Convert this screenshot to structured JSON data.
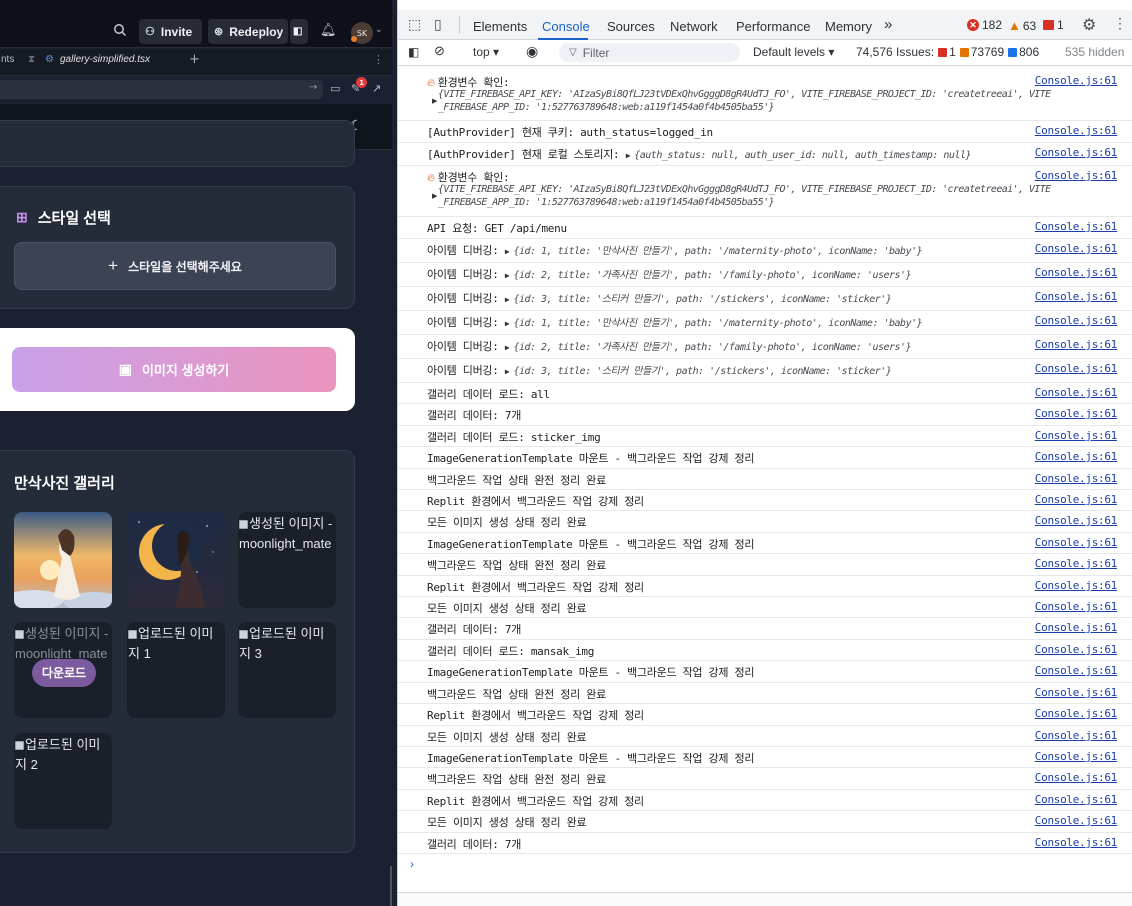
{
  "left": {
    "topbar": {
      "invite_label": "Invite",
      "redeploy_label": "Redeploy",
      "avatar_initials": "SK"
    },
    "tabs": {
      "tab1_label": "nts",
      "tab2_label": "gallery-simplified.tsx"
    },
    "url_badge": "1",
    "style_section": {
      "title": "스타일 선택",
      "button_label": "스타일을 선택해주세요"
    },
    "generate_button_label": "이미지 생성하기",
    "gallery": {
      "title": "만삭사진 갤러리",
      "tiles": [
        {
          "alt": "",
          "kind": "image-maternity-sunset"
        },
        {
          "alt": "",
          "kind": "image-moon-woman"
        },
        {
          "alt": "생성된 이미지 - moonlight_mate"
        },
        {
          "alt": "생성된 이미지 - moonlight_mate",
          "download_label": "다운로드"
        },
        {
          "alt": "업로드된 이미지 1"
        },
        {
          "alt": "업로드된 이미지 3"
        },
        {
          "alt": "업로드된 이미지 2"
        }
      ]
    }
  },
  "devtools": {
    "tabs": [
      "Elements",
      "Console",
      "Sources",
      "Network",
      "Performance",
      "Memory"
    ],
    "more_tabs": "»",
    "errors": "182",
    "warnings": "63",
    "issues_flag": "1",
    "toolbar": {
      "context": "top ▾",
      "filter_placeholder": "Filter",
      "levels": "Default levels ▾",
      "issues_label": "74,576 Issues:",
      "issues_red": "1",
      "issues_orange": "73769",
      "issues_blue": "806",
      "hidden": "535 hidden"
    },
    "source": "Console.js:61",
    "log": {
      "env_check": "환경변수 확인:",
      "env_line1": "{VITE_FIREBASE_API_KEY: 'AIzaSyBi8QfLJ23tVDExQhvGgggD8gR4UdTJ_FO', VITE_FIREBASE_PROJECT_ID: 'createtreeai', VITE",
      "env_line2": "_FIREBASE_APP_ID: '1:527763789648:web:a119f1454a0f4b4505ba55'}",
      "auth_cookie": "[AuthProvider] 현재 쿠키: auth_status=logged_in",
      "auth_local": "[AuthProvider] 현재 로컬 스토리지:",
      "auth_local_obj": "{auth_status: null, auth_user_id: null, auth_timestamp: null}",
      "api_req": "API 요청: GET /api/menu",
      "item_label": "아이템 디버깅:",
      "item1": "{id: 1, title: '만삭사진 만들기', path: '/maternity-photo', iconName: 'baby'}",
      "item2": "{id: 2, title: '가족사진 만들기', path: '/family-photo', iconName: 'users'}",
      "item3": "{id: 3, title: '스티커 만들기', path: '/stickers', iconName: 'sticker'}",
      "gallery_load_all": "갤러리 데이터 로드: all",
      "gallery_data_7": "갤러리 데이터: 7개",
      "gallery_load_sticker": "갤러리 데이터 로드: sticker_img",
      "mount": "ImageGenerationTemplate 마운트 - 백그라운드 작업 강제 정리",
      "bg_cleanup": "백그라운드 작업 상태 완전 정리 완료",
      "replit": "Replit 환경에서 백그라운드 작업 강제 정리",
      "all_cleanup": "모든 이미지 생성 상태 정리 완료",
      "gallery_load_mansak": "갤러리 데이터 로드: mansak_img"
    }
  },
  "colors": {
    "left_bg": "#1b2130",
    "accent_purple": "#c9a1ea",
    "accent_pink": "#ea94bd",
    "console_link": "#1a3fa8",
    "active_tab": "#1a62c9"
  }
}
